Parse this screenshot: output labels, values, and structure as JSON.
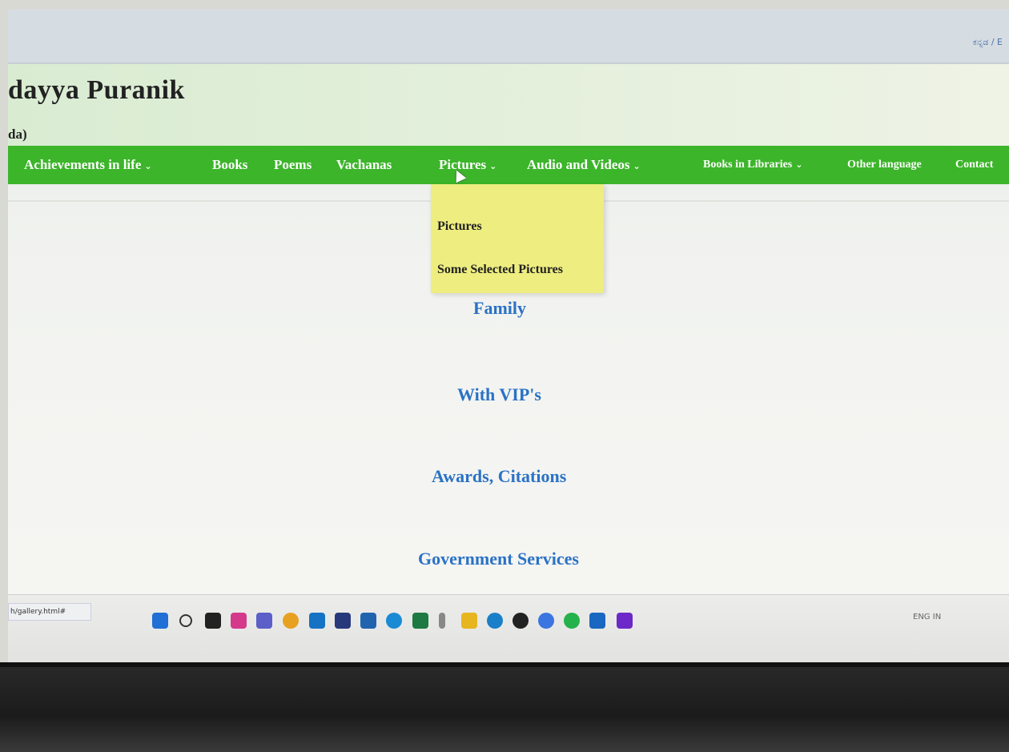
{
  "header": {
    "language_toggle": "ಕನ್ನಡ / E",
    "site_title": "dayya Puranik",
    "site_subtitle": "da)"
  },
  "nav": {
    "items": [
      {
        "label": "Achievements in life",
        "has_dropdown": true
      },
      {
        "label": "Books",
        "has_dropdown": false
      },
      {
        "label": "Poems",
        "has_dropdown": false
      },
      {
        "label": "Vachanas",
        "has_dropdown": false
      },
      {
        "label": "Pictures",
        "has_dropdown": true
      },
      {
        "label": "Audio and Videos",
        "has_dropdown": true
      },
      {
        "label": "Books in Libraries",
        "has_dropdown": true
      },
      {
        "label": "Other language",
        "has_dropdown": false
      },
      {
        "label": "Contact",
        "has_dropdown": false
      }
    ],
    "chevron": "⌄"
  },
  "dropdown": {
    "items": [
      "Pictures",
      "Some Selected Pictures"
    ]
  },
  "content": {
    "links": [
      "Family",
      "With VIP's",
      "Awards, Citations",
      "Government Services"
    ]
  },
  "status_url": "h/gallery.html#",
  "taskbar": {
    "icons": [
      "windows-start-icon",
      "search-icon",
      "task-view-icon",
      "copilot-icon",
      "teams-icon",
      "chrome-icon",
      "outlook-icon",
      "calendar-icon",
      "planner-icon",
      "edge-icon",
      "excel-icon",
      "file-icon",
      "folder-icon",
      "app-icon",
      "obs-icon",
      "signal-icon",
      "whatsapp-icon",
      "mail-icon",
      "yahoo-icon"
    ],
    "tray_lang": "ENG",
    "tray_region": "IN"
  },
  "colors": {
    "nav_green": "#3cb52a",
    "dropdown_yellow": "#eeed7f",
    "link_blue": "#2a72c5"
  }
}
